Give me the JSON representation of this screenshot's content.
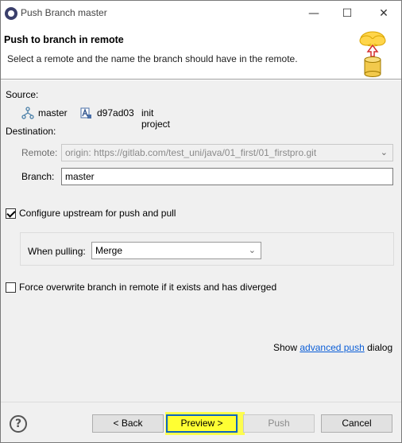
{
  "window": {
    "title": "Push Branch master",
    "minimize_glyph": "—",
    "maximize_glyph": "☐",
    "close_glyph": "✕"
  },
  "banner": {
    "title": "Push to branch in remote",
    "description": "Select a remote and the name the branch should have in the remote.",
    "icon": "cloud-push-database-icon"
  },
  "source": {
    "label": "Source:",
    "branch_name": "master",
    "commit_id": "d97ad03",
    "commit_message": "init project"
  },
  "destination": {
    "label": "Destination:",
    "remote_label": "Remote:",
    "remote_value": "origin: https://gitlab.com/test_uni/java/01_first/01_firstpro.git",
    "branch_label": "Branch:",
    "branch_value": "master"
  },
  "options": {
    "configure_upstream_label": "Configure upstream for push and pull",
    "configure_upstream_checked": true,
    "when_pulling_label": "When pulling:",
    "when_pulling_value": "Merge",
    "force_overwrite_label": "Force overwrite branch in remote if it exists and has diverged",
    "force_overwrite_checked": false
  },
  "show_push": {
    "prefix": "Show",
    "link": "advanced push",
    "suffix": "dialog"
  },
  "footer": {
    "help_glyph": "?",
    "back_label": "< Back",
    "preview_label": "Preview >",
    "push_label": "Push",
    "cancel_label": "Cancel",
    "highlight_color": "#ffff33"
  }
}
